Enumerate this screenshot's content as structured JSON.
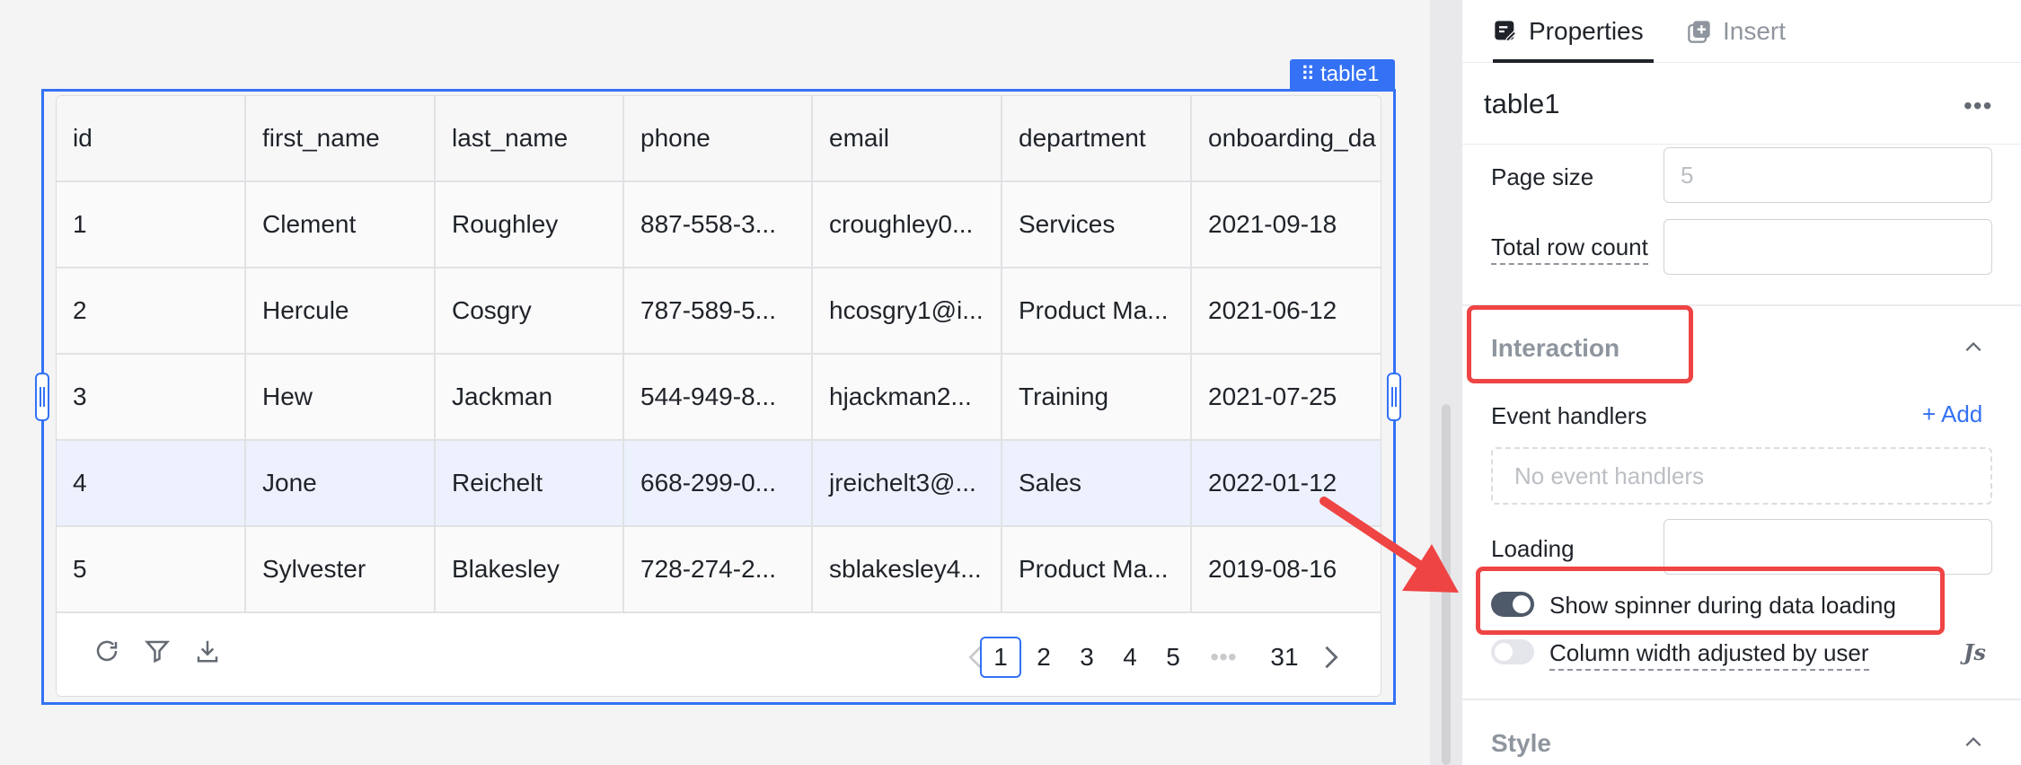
{
  "canvas": {
    "component_tag": "table1"
  },
  "table": {
    "columns": [
      "id",
      "first_name",
      "last_name",
      "phone",
      "email",
      "department",
      "onboarding_da"
    ],
    "rows": [
      [
        "1",
        "Clement",
        "Roughley",
        "887-558-3...",
        "croughley0...",
        "Services",
        "2021-09-18"
      ],
      [
        "2",
        "Hercule",
        "Cosgry",
        "787-589-5...",
        "hcosgry1@i...",
        "Product Ma...",
        "2021-06-12"
      ],
      [
        "3",
        "Hew",
        "Jackman",
        "544-949-8...",
        "hjackman2...",
        "Training",
        "2021-07-25"
      ],
      [
        "4",
        "Jone",
        "Reichelt",
        "668-299-0...",
        "jreichelt3@...",
        "Sales",
        "2022-01-12"
      ],
      [
        "5",
        "Sylvester",
        "Blakesley",
        "728-274-2...",
        "sblakesley4...",
        "Product Ma...",
        "2019-08-16"
      ]
    ],
    "highlighted_row": 4,
    "pagination": {
      "pages": [
        "1",
        "2",
        "3",
        "4",
        "5"
      ],
      "ellipsis": "•••",
      "last": "31",
      "current": "1"
    }
  },
  "panel": {
    "tabs": {
      "properties": "Properties",
      "insert": "Insert"
    },
    "component_name": "table1",
    "more": "•••",
    "page_size": {
      "label": "Page size",
      "placeholder": "5"
    },
    "total_row_count": {
      "label": "Total row count",
      "value": ""
    },
    "interaction": {
      "title": "Interaction",
      "event_handlers_label": "Event handlers",
      "add_label": "+ Add",
      "empty_text": "No event handlers",
      "loading_label": "Loading",
      "loading_value": "",
      "show_spinner_label": "Show spinner during data loading",
      "show_spinner_on": true,
      "column_width_label": "Column width adjusted by user",
      "column_width_on": false,
      "js_label": "Js"
    },
    "style": {
      "title": "Style"
    }
  },
  "colors": {
    "accent": "#3471f4",
    "annotation": "#ef4444",
    "row_highlight": "#ecf1fd"
  }
}
